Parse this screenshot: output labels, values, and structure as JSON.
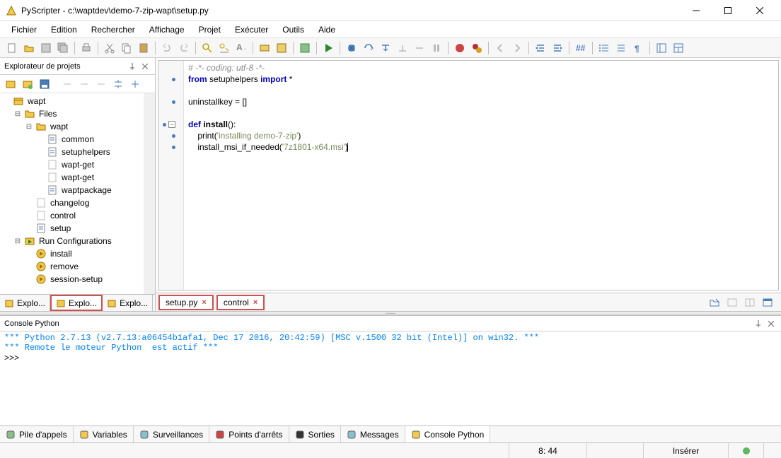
{
  "title": "PyScripter - c:\\waptdev\\demo-7-zip-wapt\\setup.py",
  "menu": [
    "Fichier",
    "Edition",
    "Rechercher",
    "Affichage",
    "Projet",
    "Exécuter",
    "Outils",
    "Aide"
  ],
  "sidebar": {
    "panel_title": "Explorateur de projets",
    "tree": [
      {
        "level": 0,
        "exp": "",
        "icon": "box",
        "label": "wapt"
      },
      {
        "level": 1,
        "exp": "-",
        "icon": "folder",
        "label": "Files"
      },
      {
        "level": 2,
        "exp": "-",
        "icon": "folder",
        "label": "wapt"
      },
      {
        "level": 3,
        "exp": "",
        "icon": "py",
        "label": "common"
      },
      {
        "level": 3,
        "exp": "",
        "icon": "py",
        "label": "setuphelpers"
      },
      {
        "level": 3,
        "exp": "",
        "icon": "file",
        "label": "wapt-get"
      },
      {
        "level": 3,
        "exp": "",
        "icon": "file",
        "label": "wapt-get"
      },
      {
        "level": 3,
        "exp": "",
        "icon": "py",
        "label": "waptpackage"
      },
      {
        "level": 2,
        "exp": "",
        "icon": "file",
        "label": "changelog"
      },
      {
        "level": 2,
        "exp": "",
        "icon": "file",
        "label": "control"
      },
      {
        "level": 2,
        "exp": "",
        "icon": "py",
        "label": "setup"
      },
      {
        "level": 1,
        "exp": "-",
        "icon": "run",
        "label": "Run Configurations"
      },
      {
        "level": 2,
        "exp": "",
        "icon": "run-item",
        "label": "install"
      },
      {
        "level": 2,
        "exp": "",
        "icon": "run-item",
        "label": "remove"
      },
      {
        "level": 2,
        "exp": "",
        "icon": "run-item",
        "label": "session-setup"
      }
    ],
    "tabs": [
      "Explo...",
      "Explo...",
      "Explo..."
    ]
  },
  "editor": {
    "lines": [
      {
        "dot": false,
        "fold": "",
        "html": "<span class='c-comment'># -*- coding: utf-8 -*-</span>"
      },
      {
        "dot": true,
        "fold": "",
        "html": "<span class='c-kw'>from</span> <span class='c-ident'>setuphelpers</span> <span class='c-kw'>import</span> *"
      },
      {
        "dot": false,
        "fold": "",
        "html": ""
      },
      {
        "dot": true,
        "fold": "",
        "html": "<span class='c-ident'>uninstallkey</span> = []"
      },
      {
        "dot": false,
        "fold": "",
        "html": ""
      },
      {
        "dot": true,
        "fold": "-",
        "html": "<span class='c-kw'>def</span> <span class='c-def'>install</span>():"
      },
      {
        "dot": true,
        "fold": "",
        "html": "    <span class='c-func'>print</span>(<span class='c-str'>'installing demo-7-zip'</span>)"
      },
      {
        "dot": true,
        "fold": "",
        "html": "    <span class='c-func'>install_msi_if_needed</span>(<span class='c-str'>'7z1801-x64.msi'</span>)<span class='cursor-bar'></span>"
      }
    ],
    "tabs": [
      {
        "label": "setup.py",
        "close": true,
        "highlight": true
      },
      {
        "label": "control",
        "close": true,
        "highlight": true
      }
    ]
  },
  "console": {
    "title": "Console Python",
    "lines": [
      "*** Python 2.7.13 (v2.7.13:a06454b1afa1, Dec 17 2016, 20:42:59) [MSC v.1500 32 bit (Intel)] on win32. ***",
      "*** Remote le moteur Python  est actif ***"
    ],
    "prompt": ">>> "
  },
  "bottom_tabs": [
    "Pile d'appels",
    "Variables",
    "Surveillances",
    "Points d'arrêts",
    "Sorties",
    "Messages",
    "Console Python"
  ],
  "status": {
    "pos": "8: 44",
    "mode": "Insérer"
  }
}
